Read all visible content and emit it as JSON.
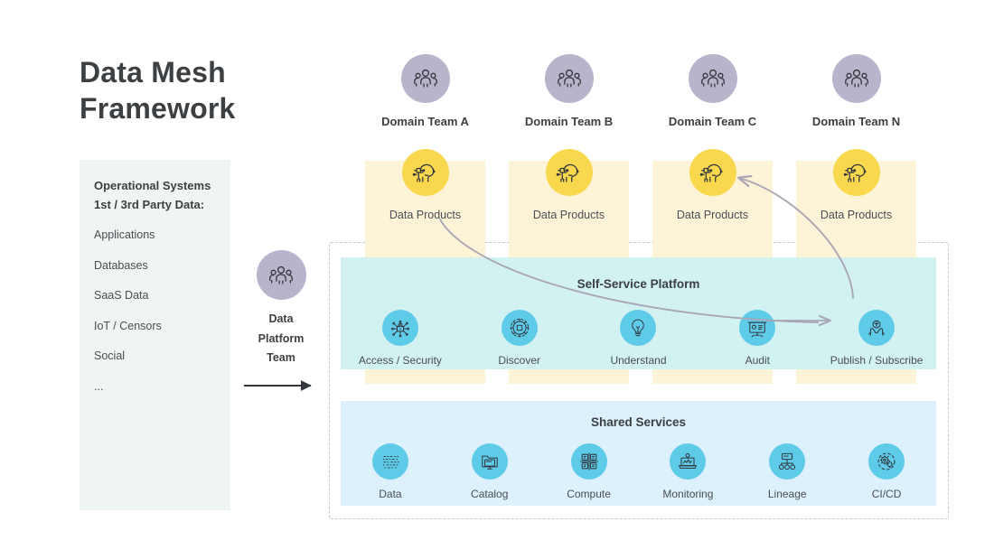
{
  "page": {
    "title": "Data Mesh Framework",
    "title_line1": "Data Mesh",
    "title_line2": "Framework"
  },
  "colors": {
    "title_text": "#3c4043",
    "body_text": "#4a4d55",
    "ops_panel_bg": "#eff6f1",
    "team_circle": "#b9b4cb",
    "data_product_circle": "#f9d84e",
    "domain_band": "#fdf4d8",
    "self_service_band": "#d2f2f2",
    "shared_services_band": "#ddf1fc",
    "service_circle": "#5ecbe8",
    "dashed_border": "#c3c7cf",
    "flow_arrow": "#a9a6b5",
    "platform_arrow": "#3c4043"
  },
  "operational_panel": {
    "heading_line1": "Operational Systems",
    "heading_line2": "1st / 3rd Party Data:",
    "items": [
      {
        "label": "Applications"
      },
      {
        "label": "Databases"
      },
      {
        "label": "SaaS Data"
      },
      {
        "label": "IoT / Censors"
      },
      {
        "label": "Social"
      },
      {
        "label": "..."
      }
    ]
  },
  "platform_team": {
    "icon": "people-group-icon",
    "label_line1": "Data",
    "label_line2": "Platform",
    "label_line3": "Team",
    "arrow": "right-arrow-icon"
  },
  "domains": [
    {
      "team_label": "Domain Team A",
      "team_icon": "people-group-icon",
      "product_label": "Data Products",
      "product_icon": "brain-circuit-head-icon"
    },
    {
      "team_label": "Domain Team B",
      "team_icon": "people-group-icon",
      "product_label": "Data Products",
      "product_icon": "brain-circuit-head-icon"
    },
    {
      "team_label": "Domain Team C",
      "team_icon": "people-group-icon",
      "product_label": "Data Products",
      "product_icon": "brain-circuit-head-icon"
    },
    {
      "team_label": "Domain Team N",
      "team_icon": "people-group-icon",
      "product_label": "Data Products",
      "product_icon": "brain-circuit-head-icon"
    }
  ],
  "self_service_platform": {
    "title": "Self-Service Platform",
    "items": [
      {
        "label": "Access / Security",
        "icon": "lock-circuit-icon"
      },
      {
        "label": "Discover",
        "icon": "discover-target-icon"
      },
      {
        "label": "Understand",
        "icon": "lightbulb-icon"
      },
      {
        "label": "Audit",
        "icon": "presentation-board-icon"
      },
      {
        "label": "Publish / Subscribe",
        "icon": "hands-share-icon"
      }
    ]
  },
  "shared_services": {
    "title": "Shared Services",
    "items": [
      {
        "label": "Data",
        "icon": "binary-data-icon"
      },
      {
        "label": "Catalog",
        "icon": "folder-monitor-icon"
      },
      {
        "label": "Compute",
        "icon": "compute-grid-icon"
      },
      {
        "label": "Monitoring",
        "icon": "laptop-monitoring-icon"
      },
      {
        "label": "Lineage",
        "icon": "lineage-tree-icon"
      },
      {
        "label": "CI/CD",
        "icon": "cicd-gears-icon"
      }
    ]
  },
  "flows": [
    {
      "name": "data-products-a-to-publish-subscribe",
      "from": "Data Products (Domain Team A)",
      "to": "Publish / Subscribe"
    },
    {
      "name": "publish-subscribe-to-data-products-c",
      "from": "Publish / Subscribe",
      "to": "Data Products (Domain Team C)"
    },
    {
      "name": "audit-to-publish-subscribe",
      "from": "Audit",
      "to": "Publish / Subscribe"
    },
    {
      "name": "operational-systems-to-platform",
      "from": "Data Platform Team",
      "to": "Self-Service Platform"
    }
  ]
}
